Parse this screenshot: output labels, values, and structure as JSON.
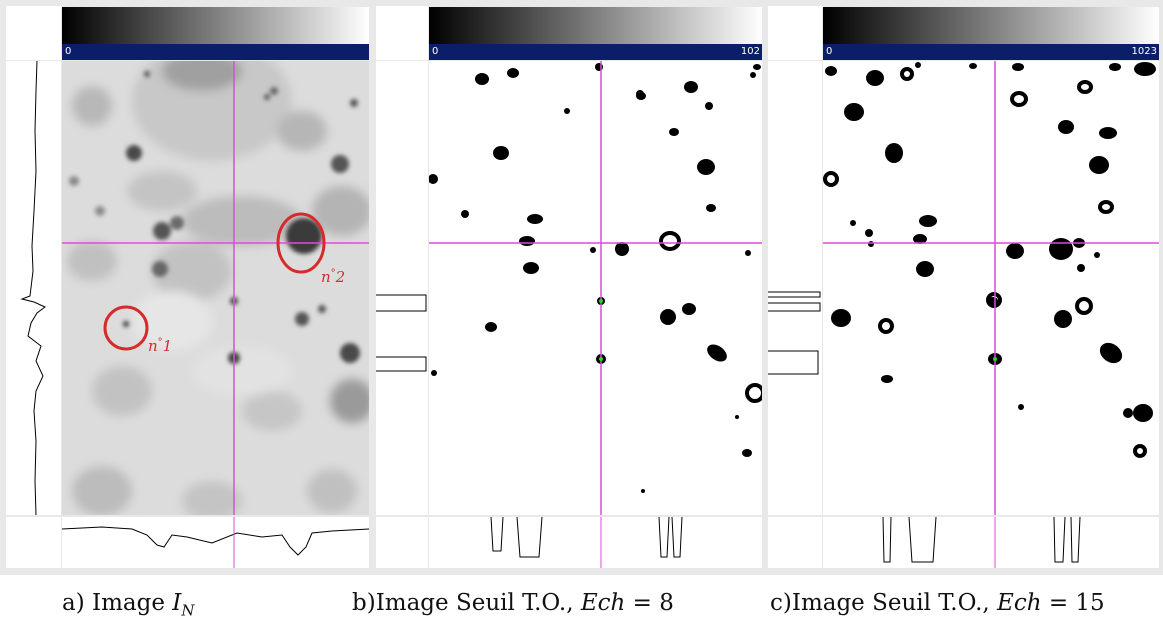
{
  "panels": [
    {
      "id": "a",
      "scale_min": "0",
      "scale_max": "",
      "caption_prefix": "a) Image ",
      "caption_var": "I",
      "caption_sub": "N",
      "caption_suffix": "",
      "caption_value": ""
    },
    {
      "id": "b",
      "scale_min": "0",
      "scale_max": "102",
      "caption_prefix": "b)Image Seuil T.O., ",
      "caption_var": "Ech",
      "caption_sub": "",
      "caption_suffix": " = ",
      "caption_value": "8"
    },
    {
      "id": "c",
      "scale_min": "0",
      "scale_max": "1023",
      "caption_prefix": "c)Image Seuil T.O., ",
      "caption_var": "Ech",
      "caption_sub": "",
      "caption_suffix": " = ",
      "caption_value": "15"
    }
  ],
  "annotations": {
    "spot1": {
      "prefix": "n",
      "degree": "°",
      "number": "1"
    },
    "spot2": {
      "prefix": "n",
      "degree": "°",
      "number": "2"
    }
  },
  "colors": {
    "crosshair": "#d94fd9",
    "annotation": "#d62b2b",
    "colorbar": "#0b1e6a",
    "crosshair_center": "#33cc33"
  },
  "icons": {
    "annotation_marker": "red-circle-icon"
  }
}
